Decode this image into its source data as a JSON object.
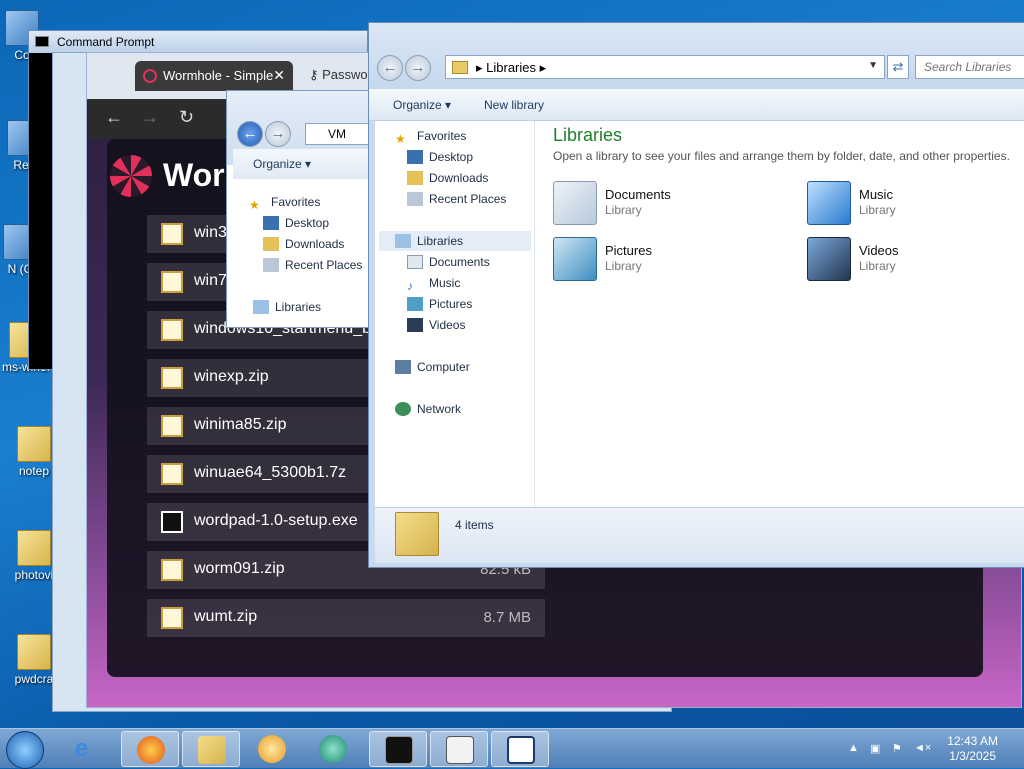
{
  "desktop": {
    "icons": [
      {
        "label": "Co"
      },
      {
        "label": "Rec"
      },
      {
        "label": "N (C"
      },
      {
        "label": "ms-win3."
      },
      {
        "label": "notep"
      },
      {
        "label": "photovi"
      },
      {
        "label": "pwdcra"
      }
    ]
  },
  "cmd_window": {
    "title": "Command Prompt"
  },
  "browser": {
    "tab_title": "Wormhole - Simple",
    "tab_close": "✕",
    "tab2_title": "Passwo",
    "back": "←",
    "forward": "→",
    "reload": "↻",
    "site_name": "Worm",
    "files": [
      {
        "name": "win3",
        "size": "",
        "icon": "zip"
      },
      {
        "name": "win7",
        "size": "",
        "icon": "zip"
      },
      {
        "name": "windows10_startmenu_b",
        "size": "",
        "icon": "zip"
      },
      {
        "name": "winexp.zip",
        "size": "",
        "icon": "zip"
      },
      {
        "name": "winima85.zip",
        "size": "",
        "icon": "zip"
      },
      {
        "name": "winuae64_5300b1.7z",
        "size": "",
        "icon": "zip"
      },
      {
        "name": "wordpad-1.0-setup.exe",
        "size": "",
        "icon": "exe"
      },
      {
        "name": "worm091.zip",
        "size": "82.5 kB",
        "icon": "zip"
      },
      {
        "name": "wumt.zip",
        "size": "8.7 MB",
        "icon": "zip"
      }
    ]
  },
  "small_explorer": {
    "address": "VM",
    "organize": "Organize ▾",
    "nav": [
      "Favorites",
      "Desktop",
      "Downloads",
      "Recent Places",
      "Libraries"
    ]
  },
  "explorer": {
    "address_path": "Libraries",
    "search_placeholder": "Search Libraries",
    "toolbar": {
      "organize": "Organize ▾",
      "new_library": "New library"
    },
    "nav": {
      "favorites": "Favorites",
      "desktop": "Desktop",
      "downloads": "Downloads",
      "recent": "Recent Places",
      "libraries": "Libraries",
      "documents": "Documents",
      "music": "Music",
      "pictures": "Pictures",
      "videos": "Videos",
      "computer": "Computer",
      "network": "Network"
    },
    "heading": "Libraries",
    "subheading": "Open a library to see your files and arrange them by folder, date, and other properties.",
    "libraries": [
      {
        "name": "Documents",
        "type": "Library"
      },
      {
        "name": "Music",
        "type": "Library"
      },
      {
        "name": "Pictures",
        "type": "Library"
      },
      {
        "name": "Videos",
        "type": "Library"
      }
    ],
    "status": "4 items"
  },
  "taskbar": {
    "time": "12:43 AM",
    "date": "1/3/2025"
  }
}
